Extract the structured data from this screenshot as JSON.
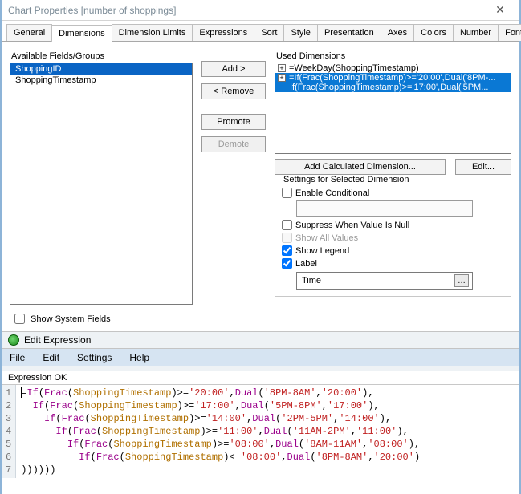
{
  "window": {
    "title": "Chart Properties [number of shoppings]"
  },
  "tabs": [
    "General",
    "Dimensions",
    "Dimension Limits",
    "Expressions",
    "Sort",
    "Style",
    "Presentation",
    "Axes",
    "Colors",
    "Number",
    "Font"
  ],
  "active_tab": "Dimensions",
  "labels": {
    "available": "Available Fields/Groups",
    "used": "Used Dimensions",
    "show_system": "Show System Fields"
  },
  "available": [
    {
      "text": "ShoppingID",
      "selected": true
    },
    {
      "text": "ShoppingTimestamp",
      "selected": false
    }
  ],
  "buttons": {
    "add": "Add >",
    "remove": "< Remove",
    "promote": "Promote",
    "demote": "Demote",
    "add_calc": "Add Calculated Dimension...",
    "edit": "Edit..."
  },
  "used_dims": [
    {
      "text": "=WeekDay(ShoppingTimestamp)",
      "selected": false
    },
    {
      "text": "=If(Frac(ShoppingTimestamp)>='20:00',Dual('8PM-...",
      "selected": true
    },
    {
      "text2": "If(Frac(ShoppingTimestamp)>='17:00',Dual('5PM..."
    }
  ],
  "settings": {
    "group_title": "Settings for Selected Dimension",
    "enable_cond": "Enable Conditional",
    "suppress_null": "Suppress When Value Is Null",
    "show_all": "Show All Values",
    "show_legend": "Show Legend",
    "label": "Label",
    "label_value": "Time"
  },
  "editor": {
    "title": "Edit Expression",
    "menu": [
      "File",
      "Edit",
      "Settings",
      "Help"
    ],
    "status": "Expression OK",
    "lines": [
      {
        "pre": "=",
        "fn1": "If",
        "op1": "(",
        "fn2": "Frac",
        "op2": "(",
        "fld": "ShoppingTimestamp",
        "op3": ")>=",
        "s1": "'20:00'",
        "op4": ",",
        "fn3": "Dual",
        "op5": "(",
        "s2": "'8PM-8AM'",
        "op6": ",",
        "s3": "'20:00'",
        "op7": "),"
      },
      {
        "indent": 1,
        "fn1": "If",
        "op1": "(",
        "fn2": "Frac",
        "op2": "(",
        "fld": "ShoppingTimestamp",
        "op3": ")>=",
        "s1": "'17:00'",
        "op4": ",",
        "fn3": "Dual",
        "op5": "(",
        "s2": "'5PM-8PM'",
        "op6": ",",
        "s3": "'17:00'",
        "op7": "),"
      },
      {
        "indent": 2,
        "fn1": "If",
        "op1": "(",
        "fn2": "Frac",
        "op2": "(",
        "fld": "ShoppingTimestamp",
        "op3": ")>=",
        "s1": "'14:00'",
        "op4": ",",
        "fn3": "Dual",
        "op5": "(",
        "s2": "'2PM-5PM'",
        "op6": ",",
        "s3": "'14:00'",
        "op7": "),"
      },
      {
        "indent": 3,
        "fn1": "If",
        "op1": "(",
        "fn2": "Frac",
        "op2": "(",
        "fld": "ShoppingTimestamp",
        "op3": ")>=",
        "s1": "'11:00'",
        "op4": ",",
        "fn3": "Dual",
        "op5": "(",
        "s2": "'11AM-2PM'",
        "op6": ",",
        "s3": "'11:00'",
        "op7": "),"
      },
      {
        "indent": 4,
        "fn1": "If",
        "op1": "(",
        "fn2": "Frac",
        "op2": "(",
        "fld": "ShoppingTimestamp",
        "op3": ")>=",
        "s1": "'08:00'",
        "op4": ",",
        "fn3": "Dual",
        "op5": "(",
        "s2": "'8AM-11AM'",
        "op6": ",",
        "s3": "'08:00'",
        "op7": "),"
      },
      {
        "indent": 5,
        "fn1": "If",
        "op1": "(",
        "fn2": "Frac",
        "op2": "(",
        "fld": "ShoppingTimestamp",
        "op3": ")< ",
        "s1": "'08:00'",
        "op4": ",",
        "fn3": "Dual",
        "op5": "(",
        "s2": "'8PM-8AM'",
        "op6": ",",
        "s3": "'20:00'",
        "op7": ")"
      },
      {
        "tail": "))))))"
      }
    ]
  }
}
